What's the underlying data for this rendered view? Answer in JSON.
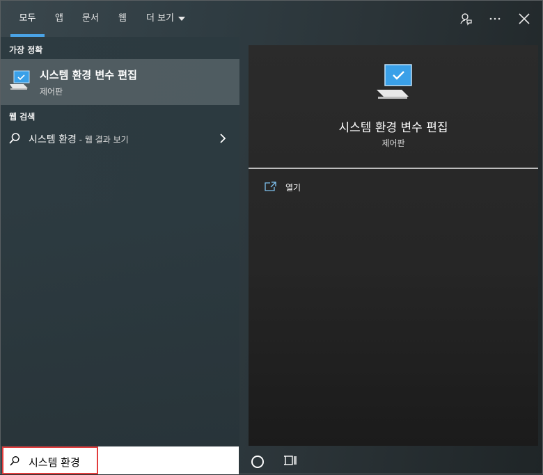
{
  "nav": {
    "tabs": [
      {
        "label": "모두"
      },
      {
        "label": "앱"
      },
      {
        "label": "문서"
      },
      {
        "label": "웹"
      },
      {
        "label": "더 보기"
      }
    ],
    "active_tab": "모두",
    "icons": [
      "feedback-icon",
      "more-options-icon",
      "close-icon"
    ],
    "accent_color": "#4aa3e6"
  },
  "results": {
    "best_match_header": "가장 정확",
    "best_match": {
      "title": "시스템 환경 변수 편집",
      "subtitle": "제어판",
      "icon": "computer-settings-icon"
    },
    "web_search_header": "웹 검색",
    "web_search": {
      "query": "시스템 환경",
      "suffix": " - 웹 결과 보기",
      "icon": "search-icon"
    }
  },
  "preview": {
    "title": "시스템 환경 변수 편집",
    "subtitle": "제어판",
    "icon": "computer-settings-icon",
    "actions": [
      {
        "label": "열기",
        "icon": "open-icon"
      }
    ]
  },
  "taskbar": {
    "search_value": "시스템 환경",
    "highlight_color": "#e23c3c",
    "icons": [
      "cortana-icon",
      "task-view-icon"
    ]
  }
}
